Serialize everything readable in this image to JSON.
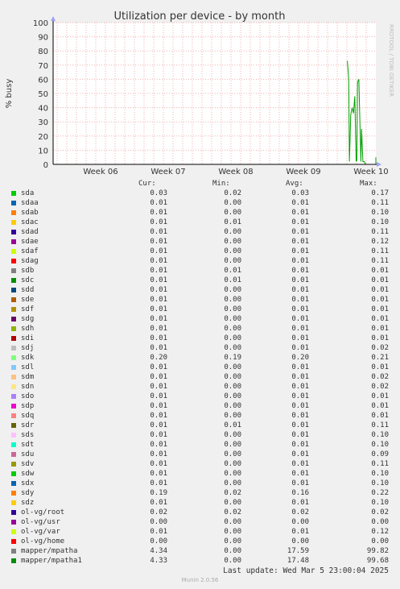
{
  "chart_data": {
    "type": "line",
    "title": "Utilization per device - by month",
    "ylabel": "% busy",
    "ylim": [
      0,
      100
    ],
    "yticks": [
      0,
      10,
      20,
      30,
      40,
      50,
      60,
      70,
      80,
      90,
      100
    ],
    "xlabels": [
      "Week 06",
      "Week 07",
      "Week 08",
      "Week 09",
      "Week 10"
    ],
    "side_label": "RRDTOOL / TOBI OETIKER",
    "series_peak": {
      "name": "mapper/mpatha",
      "color": "#00A000",
      "x_weeks": [
        9.65,
        9.67,
        9.68,
        9.7,
        9.72,
        9.74,
        9.76,
        9.78,
        9.79,
        9.8,
        9.82,
        9.83,
        9.85,
        9.86,
        9.88,
        9.9,
        9.92,
        9.95,
        10.1,
        10.12
      ],
      "values": [
        73,
        60,
        2,
        35,
        40,
        36,
        48,
        2,
        3,
        58,
        60,
        40,
        2,
        25,
        2,
        2,
        0,
        0,
        0,
        5
      ]
    }
  },
  "legend": {
    "headers": [
      "Cur:",
      "Min:",
      "Avg:",
      "Max:"
    ],
    "rows": [
      {
        "name": "sda",
        "color": "#00CC00",
        "cur": "0.03",
        "min": "0.02",
        "avg": "0.03",
        "max": "0.17"
      },
      {
        "name": "sdaa",
        "color": "#0066B3",
        "cur": "0.01",
        "min": "0.00",
        "avg": "0.01",
        "max": "0.11"
      },
      {
        "name": "sdab",
        "color": "#FF8000",
        "cur": "0.01",
        "min": "0.00",
        "avg": "0.01",
        "max": "0.10"
      },
      {
        "name": "sdac",
        "color": "#FFCC00",
        "cur": "0.01",
        "min": "0.01",
        "avg": "0.01",
        "max": "0.10"
      },
      {
        "name": "sdad",
        "color": "#330099",
        "cur": "0.01",
        "min": "0.00",
        "avg": "0.01",
        "max": "0.11"
      },
      {
        "name": "sdae",
        "color": "#990099",
        "cur": "0.01",
        "min": "0.00",
        "avg": "0.01",
        "max": "0.12"
      },
      {
        "name": "sdaf",
        "color": "#CCFF00",
        "cur": "0.01",
        "min": "0.00",
        "avg": "0.01",
        "max": "0.11"
      },
      {
        "name": "sdag",
        "color": "#FF0000",
        "cur": "0.01",
        "min": "0.00",
        "avg": "0.01",
        "max": "0.11"
      },
      {
        "name": "sdb",
        "color": "#808080",
        "cur": "0.01",
        "min": "0.01",
        "avg": "0.01",
        "max": "0.01"
      },
      {
        "name": "sdc",
        "color": "#008F00",
        "cur": "0.01",
        "min": "0.01",
        "avg": "0.01",
        "max": "0.01"
      },
      {
        "name": "sdd",
        "color": "#00487D",
        "cur": "0.01",
        "min": "0.00",
        "avg": "0.01",
        "max": "0.01"
      },
      {
        "name": "sde",
        "color": "#B35A00",
        "cur": "0.01",
        "min": "0.00",
        "avg": "0.01",
        "max": "0.01"
      },
      {
        "name": "sdf",
        "color": "#B38F00",
        "cur": "0.01",
        "min": "0.00",
        "avg": "0.01",
        "max": "0.01"
      },
      {
        "name": "sdg",
        "color": "#6B006B",
        "cur": "0.01",
        "min": "0.00",
        "avg": "0.01",
        "max": "0.01"
      },
      {
        "name": "sdh",
        "color": "#8FB300",
        "cur": "0.01",
        "min": "0.00",
        "avg": "0.01",
        "max": "0.01"
      },
      {
        "name": "sdi",
        "color": "#B30000",
        "cur": "0.01",
        "min": "0.00",
        "avg": "0.01",
        "max": "0.01"
      },
      {
        "name": "sdj",
        "color": "#BEBEBE",
        "cur": "0.01",
        "min": "0.00",
        "avg": "0.01",
        "max": "0.02"
      },
      {
        "name": "sdk",
        "color": "#80FF80",
        "cur": "0.20",
        "min": "0.19",
        "avg": "0.20",
        "max": "0.21"
      },
      {
        "name": "sdl",
        "color": "#80C9FF",
        "cur": "0.01",
        "min": "0.00",
        "avg": "0.01",
        "max": "0.01"
      },
      {
        "name": "sdm",
        "color": "#FFC080",
        "cur": "0.01",
        "min": "0.00",
        "avg": "0.01",
        "max": "0.02"
      },
      {
        "name": "sdn",
        "color": "#FFE680",
        "cur": "0.01",
        "min": "0.00",
        "avg": "0.01",
        "max": "0.02"
      },
      {
        "name": "sdo",
        "color": "#AA80FF",
        "cur": "0.01",
        "min": "0.00",
        "avg": "0.01",
        "max": "0.01"
      },
      {
        "name": "sdp",
        "color": "#EE00CC",
        "cur": "0.01",
        "min": "0.00",
        "avg": "0.01",
        "max": "0.01"
      },
      {
        "name": "sdq",
        "color": "#FF8080",
        "cur": "0.01",
        "min": "0.00",
        "avg": "0.01",
        "max": "0.01"
      },
      {
        "name": "sdr",
        "color": "#666600",
        "cur": "0.01",
        "min": "0.01",
        "avg": "0.01",
        "max": "0.11"
      },
      {
        "name": "sds",
        "color": "#FFBFFF",
        "cur": "0.01",
        "min": "0.00",
        "avg": "0.01",
        "max": "0.10"
      },
      {
        "name": "sdt",
        "color": "#00FFCC",
        "cur": "0.01",
        "min": "0.00",
        "avg": "0.01",
        "max": "0.10"
      },
      {
        "name": "sdu",
        "color": "#CC6699",
        "cur": "0.01",
        "min": "0.00",
        "avg": "0.01",
        "max": "0.09"
      },
      {
        "name": "sdv",
        "color": "#999900",
        "cur": "0.01",
        "min": "0.00",
        "avg": "0.01",
        "max": "0.11"
      },
      {
        "name": "sdw",
        "color": "#00CC00",
        "cur": "0.01",
        "min": "0.00",
        "avg": "0.01",
        "max": "0.10"
      },
      {
        "name": "sdx",
        "color": "#0066B3",
        "cur": "0.01",
        "min": "0.00",
        "avg": "0.01",
        "max": "0.10"
      },
      {
        "name": "sdy",
        "color": "#FF8000",
        "cur": "0.19",
        "min": "0.02",
        "avg": "0.16",
        "max": "0.22"
      },
      {
        "name": "sdz",
        "color": "#FFCC00",
        "cur": "0.01",
        "min": "0.00",
        "avg": "0.01",
        "max": "0.10"
      },
      {
        "name": "ol-vg/root",
        "color": "#330099",
        "cur": "0.02",
        "min": "0.02",
        "avg": "0.02",
        "max": "0.02"
      },
      {
        "name": "ol-vg/usr",
        "color": "#990099",
        "cur": "0.00",
        "min": "0.00",
        "avg": "0.00",
        "max": "0.00"
      },
      {
        "name": "ol-vg/var",
        "color": "#CCFF00",
        "cur": "0.01",
        "min": "0.00",
        "avg": "0.01",
        "max": "0.12"
      },
      {
        "name": "ol-vg/home",
        "color": "#FF0000",
        "cur": "0.00",
        "min": "0.00",
        "avg": "0.00",
        "max": "0.00"
      },
      {
        "name": "mapper/mpatha",
        "color": "#808080",
        "cur": "4.34",
        "min": "0.00",
        "avg": "17.59",
        "max": "99.82"
      },
      {
        "name": "mapper/mpatha1",
        "color": "#008F00",
        "cur": "4.33",
        "min": "0.00",
        "avg": "17.48",
        "max": "99.68"
      }
    ]
  },
  "footer": {
    "last_update": "Last update: Wed Mar  5 23:00:04 2025",
    "munin": "Munin 2.0.56"
  }
}
